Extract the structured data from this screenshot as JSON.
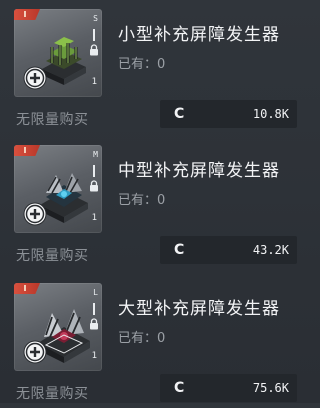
{
  "items": [
    {
      "tier": "I",
      "size": "S",
      "slot": "1",
      "name": "小型补充屏障发生器",
      "owned": "已有：0",
      "purchase_limit": "无限量购买",
      "currency": "C",
      "price": "10.8K",
      "accent_color": "#6a9b3c",
      "thumb_icon": "shield-generator-small-icon"
    },
    {
      "tier": "I",
      "size": "M",
      "slot": "1",
      "name": "中型补充屏障发生器",
      "owned": "已有：0",
      "purchase_limit": "无限量购买",
      "currency": "C",
      "price": "43.2K",
      "accent_color": "#2f9bc0",
      "thumb_icon": "shield-generator-medium-icon"
    },
    {
      "tier": "I",
      "size": "L",
      "slot": "1",
      "name": "大型补充屏障发生器",
      "owned": "已有：0",
      "purchase_limit": "无限量购买",
      "currency": "C",
      "price": "75.6K",
      "accent_color": "#a02a45",
      "thumb_icon": "shield-generator-large-icon"
    }
  ]
}
